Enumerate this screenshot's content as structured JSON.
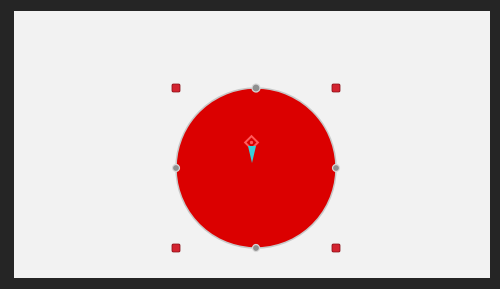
{
  "colors": {
    "window_background": "#252525",
    "canvas_background": "#f2f2f2",
    "circle_fill": "#db0000",
    "circle_outline": "#c8c8c8",
    "handle_fill": "#d3232f",
    "handle_stroke": "#8a1018",
    "rotate_handle_fill": "#8f8f8f",
    "rotate_handle_stroke": "#d7d7d7",
    "cursor_fill": "#39d0d8",
    "anchor_stroke": "#ff5b5b"
  },
  "selection": {
    "shape": "circle",
    "resize_handles": [
      "top-left",
      "top-right",
      "bottom-left",
      "bottom-right"
    ],
    "midpoint_handles": [
      "top",
      "left",
      "right",
      "bottom"
    ]
  },
  "icons": {
    "anchor": "anchor-point-icon",
    "cursor": "pointer-cursor-icon"
  }
}
